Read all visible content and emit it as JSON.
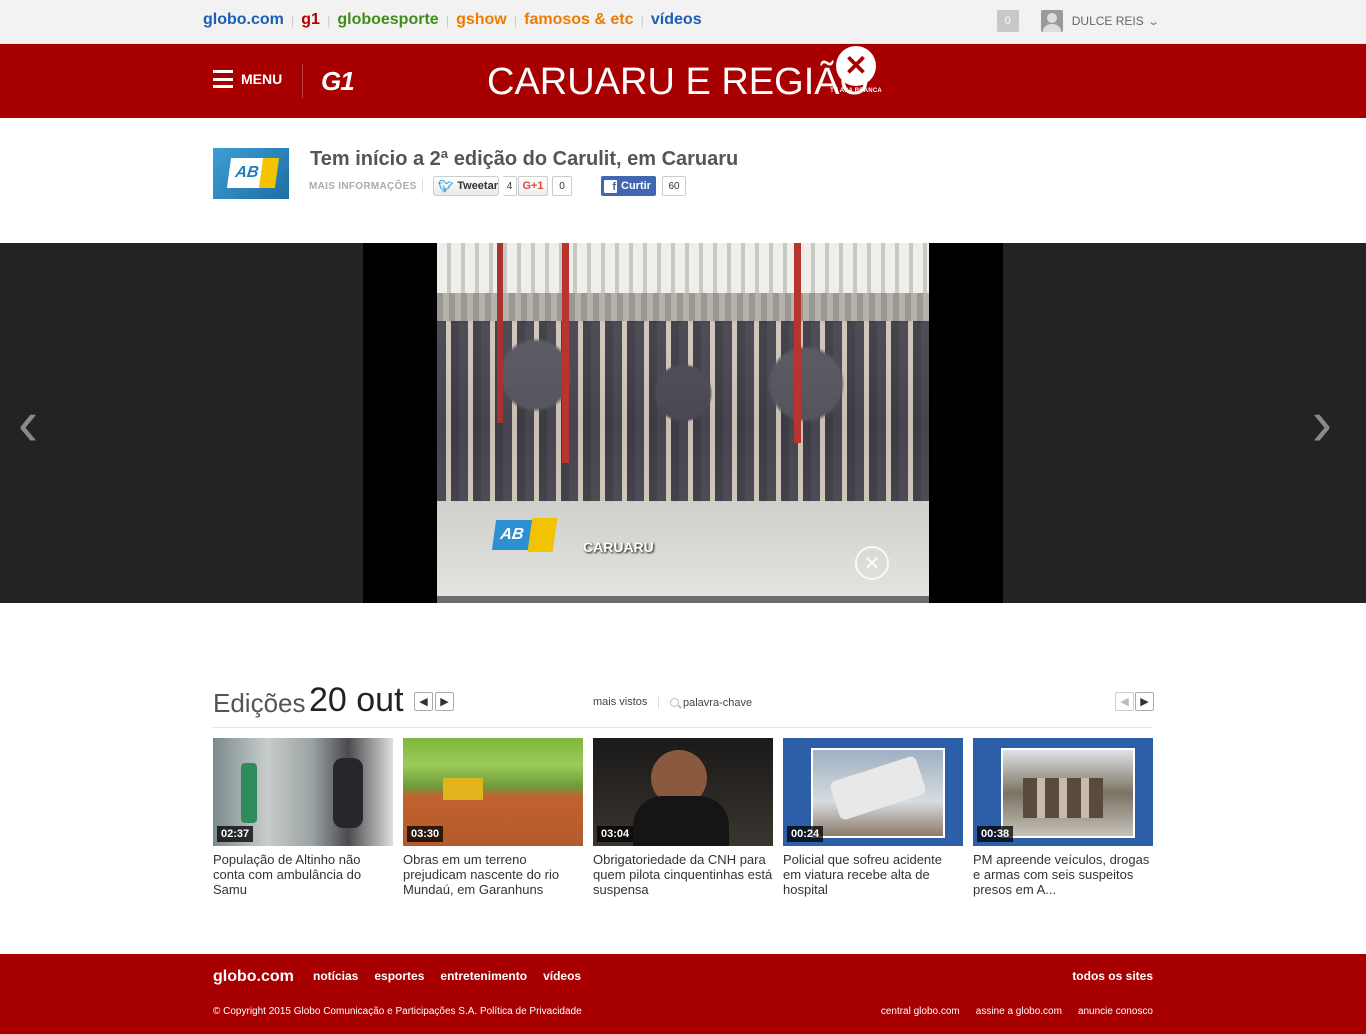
{
  "topbar": {
    "sites": [
      {
        "label": "globo.com",
        "color": "#1a5fb4"
      },
      {
        "label": "g1",
        "color": "#b10000"
      },
      {
        "label": "globoesporte",
        "color": "#3e8f1a"
      },
      {
        "label": "gshow",
        "color": "#f07b00"
      },
      {
        "label": "famosos & etc",
        "color": "#f07b00"
      },
      {
        "label": "vídeos",
        "color": "#1a5fb4"
      }
    ],
    "notifications": "0",
    "username": "DULCE REIS"
  },
  "header": {
    "menu_label": "MENU",
    "g1_logo": "G1",
    "program_title": "CARUARU E REGIÃO",
    "station_logo_text": "TV ASA BRANCA",
    "brand_color": "#a80000"
  },
  "video": {
    "title": "Tem início a 2ª edição do Carulit, em Caruaru",
    "more_info": "MAIS INFORMAÇÕES",
    "tweet_label": "Tweetar",
    "tweet_count": "4",
    "gplus_label": "G+1",
    "gplus_count": "0",
    "like_label": "Curtir",
    "like_count": "60",
    "channel_thumb": "AB",
    "overlay_logo": "AB",
    "overlay_location": "CARUARU"
  },
  "editions": {
    "label": "Edições",
    "date": "20 out",
    "most_viewed": "mais vistos",
    "search_placeholder": "palavra-chave",
    "cards": [
      {
        "duration": "02:37",
        "title": "População de Altinho não conta com ambulância do Samu"
      },
      {
        "duration": "03:30",
        "title": "Obras em um terreno prejudicam nascente do rio Mundaú, em Garanhuns"
      },
      {
        "duration": "03:04",
        "title": "Obrigatoriedade da CNH para quem pilota cinquentinhas está suspensa"
      },
      {
        "duration": "00:24",
        "title": "Policial que sofreu acidente em viatura recebe alta de hospital"
      },
      {
        "duration": "00:38",
        "title": "PM apreende veículos, drogas e armas com seis suspeitos presos em A..."
      }
    ]
  },
  "footer": {
    "logo": "globo.com",
    "nav": [
      "notícias",
      "esportes",
      "entretenimento",
      "vídeos"
    ],
    "all_sites": "todos os sites",
    "copyright": "© Copyright 2015 Globo Comunicação e Participações S.A. Política de Privacidade",
    "links": [
      "central globo.com",
      "assine a globo.com",
      "anuncie conosco"
    ]
  }
}
